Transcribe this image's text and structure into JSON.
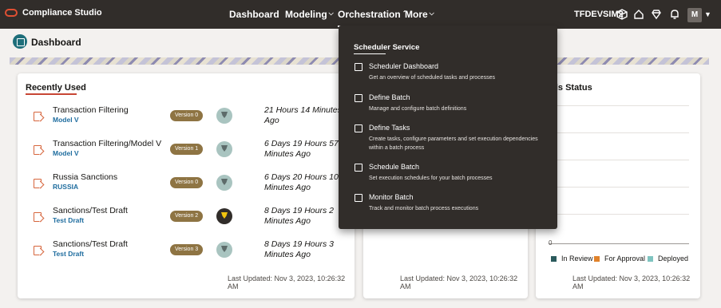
{
  "app": {
    "name": "Compliance Studio"
  },
  "topnav": {
    "items": [
      {
        "label": "Dashboard",
        "has_menu": false
      },
      {
        "label": "Modeling",
        "has_menu": true
      },
      {
        "label": "Orchestration",
        "has_menu": true,
        "active": true
      },
      {
        "label": "More",
        "has_menu": true
      }
    ],
    "environment": "TFDEVSIM2",
    "avatar_initial": "M",
    "icons": [
      "cube-icon",
      "home-icon",
      "diamond-icon",
      "bell-icon"
    ]
  },
  "page": {
    "title": "Dashboard"
  },
  "recently_used": {
    "title": "Recently Used",
    "items": [
      {
        "name": "Transaction Filtering",
        "sub": "Model V",
        "version": "Version 0",
        "time": "21 Hours 14 Minutes Ago",
        "medal": "light"
      },
      {
        "name": "Transaction Filtering/Model V",
        "sub": "Model V",
        "version": "Version 1",
        "time": "6 Days 19 Hours 57 Minutes Ago",
        "medal": "light"
      },
      {
        "name": "Russia Sanctions",
        "sub": "RUSSIA",
        "version": "Version 0",
        "time": "6 Days 20 Hours 10 Minutes Ago",
        "medal": "light"
      },
      {
        "name": "Sanctions/Test Draft",
        "sub": "Test Draft",
        "version": "Version 2",
        "time": "8 Days 19 Hours 2 Minutes Ago",
        "medal": "dark"
      },
      {
        "name": "Sanctions/Test Draft",
        "sub": "Test Draft",
        "version": "Version 3",
        "time": "8 Days 19 Hours 3 Minutes Ago",
        "medal": "light"
      }
    ],
    "last_updated": "Last Updated: Nov 3, 2023, 10:26:32 AM"
  },
  "middle_card": {
    "last_updated": "Last Updated: Nov 3, 2023, 10:26:32 AM"
  },
  "models_status": {
    "title": "dels Status",
    "zero_label": "0",
    "legend": [
      {
        "label": "In Review",
        "color": "#2b5a5c"
      },
      {
        "label": "For Approval",
        "color": "#e0822b"
      },
      {
        "label": "Deployed",
        "color": "#7fc4c0"
      }
    ],
    "last_updated": "Last Updated: Nov 3, 2023, 10:26:32 AM"
  },
  "orchestration_menu": {
    "header": "Scheduler Service",
    "items": [
      {
        "title": "Scheduler Dashboard",
        "desc": "Get an overview of scheduled tasks and processes",
        "icon": "dashboard-icon"
      },
      {
        "title": "Define Batch",
        "desc": "Manage and configure batch definitions",
        "icon": "layers-icon"
      },
      {
        "title": "Define Tasks",
        "desc": "Create tasks, configure parameters and set execution dependencies within a batch process",
        "icon": "document-icon"
      },
      {
        "title": "Schedule Batch",
        "desc": "Set execution schedules for your batch processes",
        "icon": "calendar-icon"
      },
      {
        "title": "Monitor Batch",
        "desc": "Track and monitor batch process executions",
        "icon": "monitor-icon"
      }
    ]
  }
}
